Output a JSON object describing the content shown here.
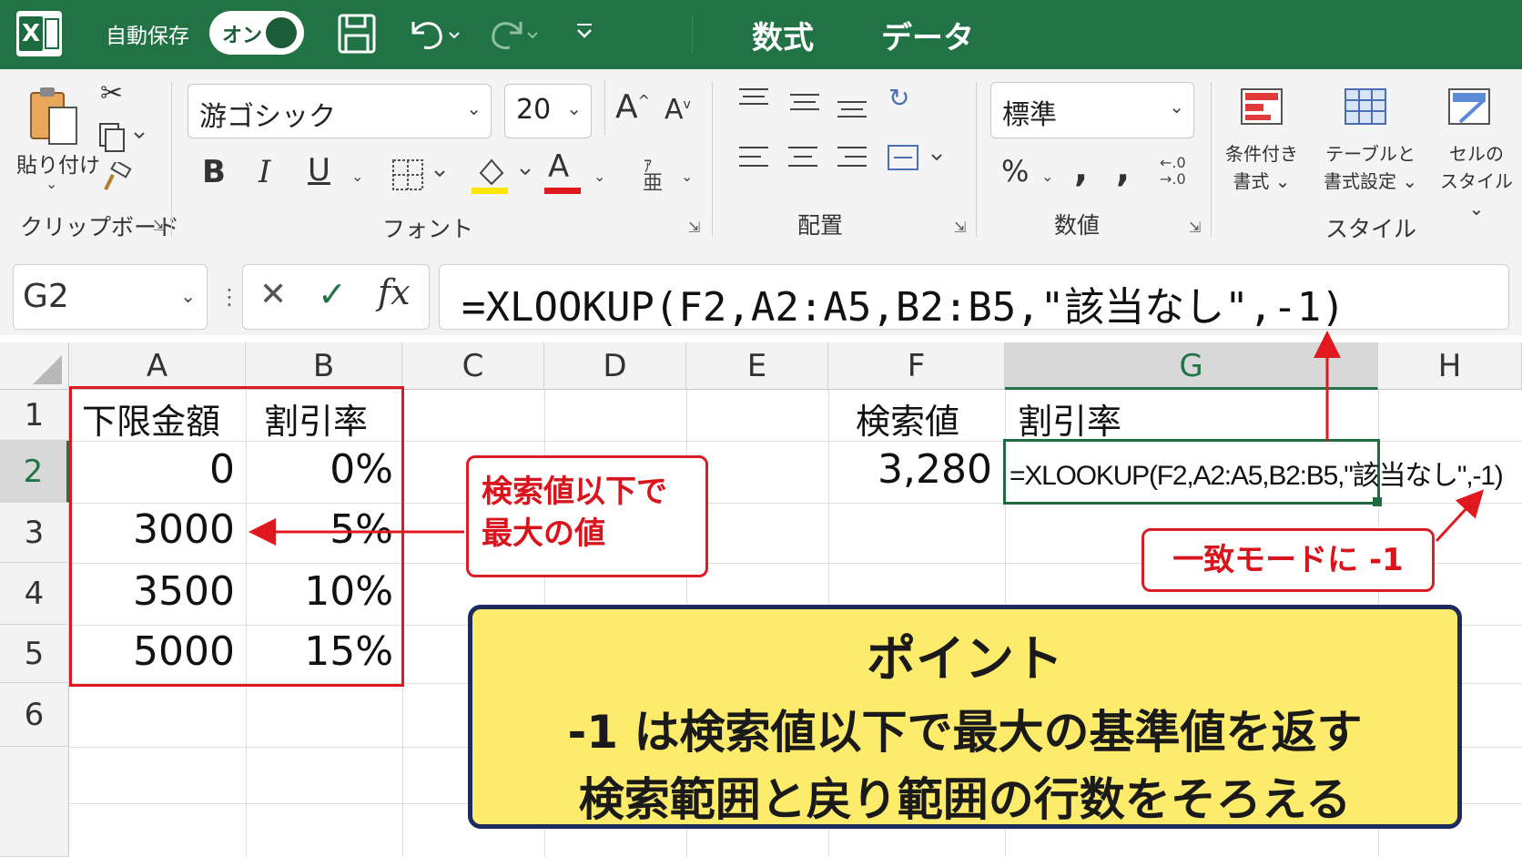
{
  "titlebar": {
    "autosave_label": "自動保存",
    "autosave_state": "オン",
    "tabs": [
      "数式",
      "データ"
    ]
  },
  "ribbon": {
    "clipboard": {
      "paste_label": "貼り付け",
      "group_label": "クリップボード"
    },
    "font": {
      "font_name": "游ゴシック",
      "font_size": "20",
      "group_label": "フォント",
      "bold": "B",
      "italic": "I",
      "underline": "U",
      "font_color_glyph": "A"
    },
    "alignment": {
      "group_label": "配置"
    },
    "number": {
      "format": "標準",
      "group_label": "数値",
      "percent": "%"
    },
    "styles": {
      "conditional": [
        "条件付き",
        "書式"
      ],
      "table": [
        "テーブルと",
        "書式設定"
      ],
      "cell": [
        "セルの",
        "スタイル"
      ],
      "group_label": "スタイル"
    }
  },
  "formula_bar": {
    "name_box": "G2",
    "formula": "=XLOOKUP(F2,A2:A5,B2:B5,\"該当なし\",-1)"
  },
  "sheet": {
    "columns": [
      "A",
      "B",
      "C",
      "D",
      "E",
      "F",
      "G",
      "H"
    ],
    "rows": [
      "1",
      "2",
      "3",
      "4",
      "5",
      "6"
    ],
    "A1": "下限金額",
    "B1": "割引率",
    "A2": "0",
    "B2": "0%",
    "A3": "3000",
    "B3": "5%",
    "A4": "3500",
    "B4": "10%",
    "A5": "5000",
    "B5": "15%",
    "F1": "検索値",
    "G1": "割引率",
    "F2": "3,280",
    "G2": "=XLOOKUP(F2,A2:A5,B2:B5,\"該当なし\",-1)"
  },
  "annotations": {
    "callout_left": [
      "検索値以下で",
      "最大の値"
    ],
    "callout_right": "一致モードに -1",
    "point_title": "ポイント",
    "point_lines": [
      "-1 は検索値以下で最大の基準値を返す",
      "検索範囲と戻り範囲の行数をそろえる"
    ]
  },
  "colors": {
    "excel_green": "#217346",
    "annotation_red": "#e0191f",
    "point_fill": "#fdec6b",
    "point_border": "#1d2b5c"
  }
}
